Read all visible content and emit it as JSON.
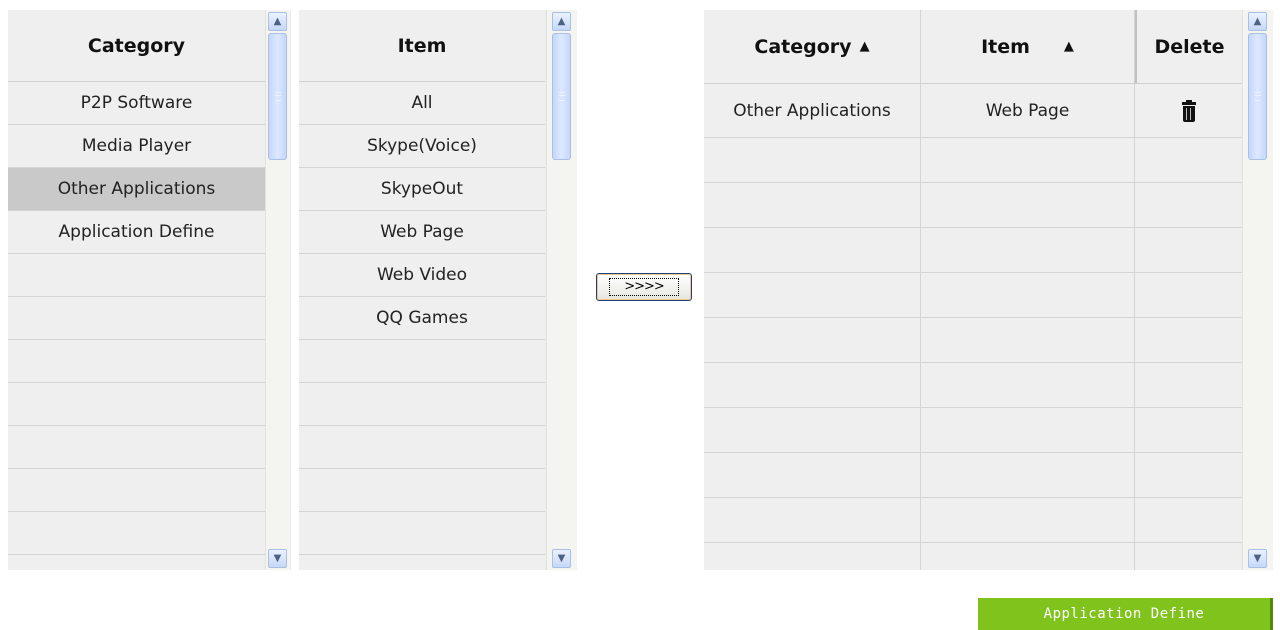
{
  "category_list": {
    "header": "Category",
    "items": [
      "P2P Software",
      "Media Player",
      "Other Applications",
      "Application Define",
      "",
      "",
      "",
      "",
      "",
      "",
      "",
      ""
    ],
    "selected": "Other Applications"
  },
  "item_list": {
    "header": "Item",
    "items": [
      "All",
      "Skype(Voice)",
      "SkypeOut",
      "Web Page",
      "Web Video",
      "QQ Games",
      "",
      "",
      "",
      "",
      "",
      ""
    ]
  },
  "move_button": {
    "label": ">>>>"
  },
  "selected_table": {
    "headers": {
      "category": "Category",
      "item": "Item",
      "delete": "Delete"
    },
    "sort_arrow": "▲",
    "rows": [
      {
        "category": "Other Applications",
        "item": "Web Page",
        "delete_icon": "trash-icon"
      }
    ],
    "empty_rows": 10
  },
  "app_define_button": {
    "label": "Application Define"
  },
  "colors": {
    "panel_bg": "#efefef",
    "selected_row": "#c9c9c9",
    "accent_green": "#7fc31c"
  }
}
